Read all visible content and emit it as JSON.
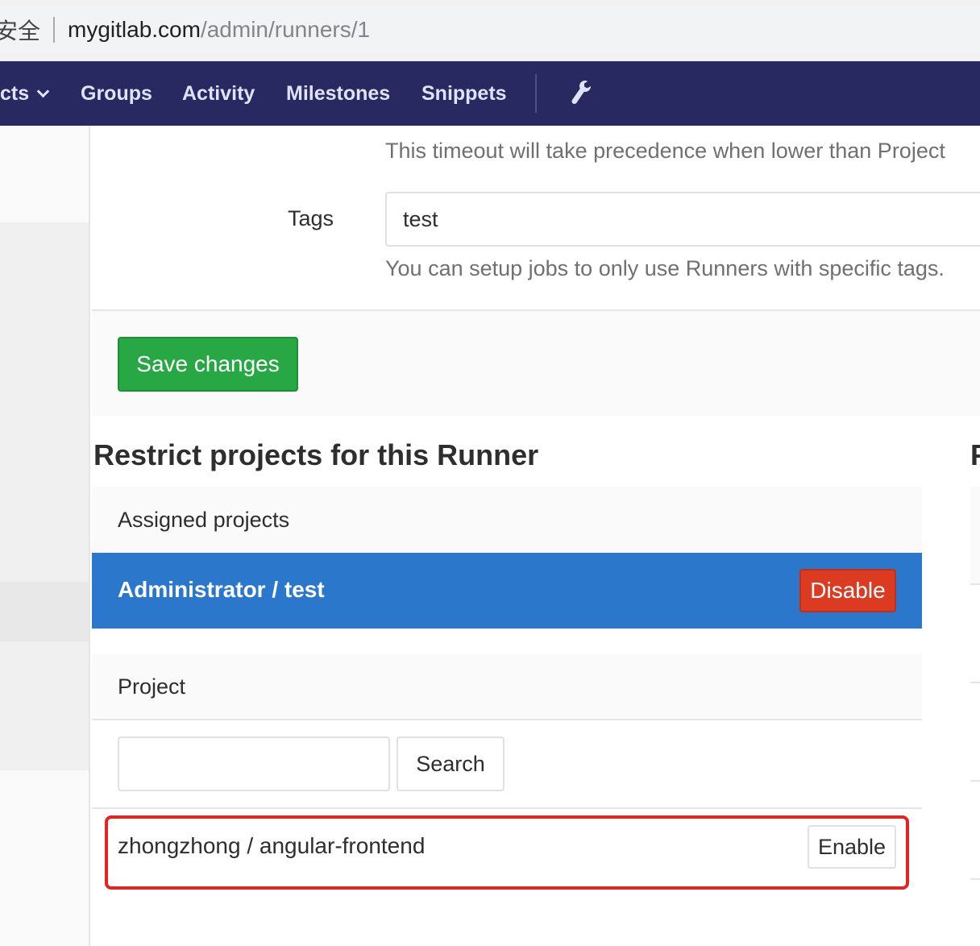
{
  "browser": {
    "security_label": "安全",
    "url_host": "mygitlab.com",
    "url_path": "/admin/runners/1"
  },
  "navbar": {
    "items": [
      {
        "label": "cts"
      },
      {
        "label": "Groups"
      },
      {
        "label": "Activity"
      },
      {
        "label": "Milestones"
      },
      {
        "label": "Snippets"
      }
    ],
    "admin_icon": "wrench-icon"
  },
  "form": {
    "timeout_help": "This timeout will take precedence when lower than Project",
    "tags_label": "Tags",
    "tags_value": "test",
    "tags_help": "You can setup jobs to only use Runners with specific tags.",
    "save_label": "Save changes"
  },
  "restrict": {
    "title": "Restrict projects for this Runner",
    "right_title": "P",
    "assigned_header": "Assigned projects",
    "assigned": [
      {
        "name": "Administrator / test",
        "action": "Disable"
      }
    ],
    "project_header": "Project",
    "search_value": "",
    "search_label": "Search",
    "projects": [
      {
        "name": "zhongzhong / angular-frontend",
        "action": "Enable"
      }
    ]
  },
  "colors": {
    "navbar": "#292961",
    "save": "#28a745",
    "assigned_row": "#2b77cb",
    "disable": "#db3b21",
    "highlight": "#e8231f"
  }
}
